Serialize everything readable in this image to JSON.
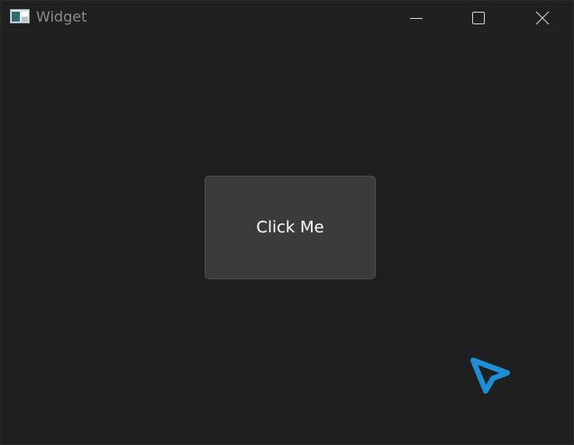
{
  "window": {
    "title": "Widget",
    "controls": {
      "minimize": "minimize-icon",
      "maximize": "maximize-icon",
      "close": "close-icon"
    }
  },
  "main": {
    "button_label": "Click Me"
  },
  "colors": {
    "background": "#1f1f1f",
    "button": "#3b3b3b",
    "cursor": "#1e8fd6"
  }
}
